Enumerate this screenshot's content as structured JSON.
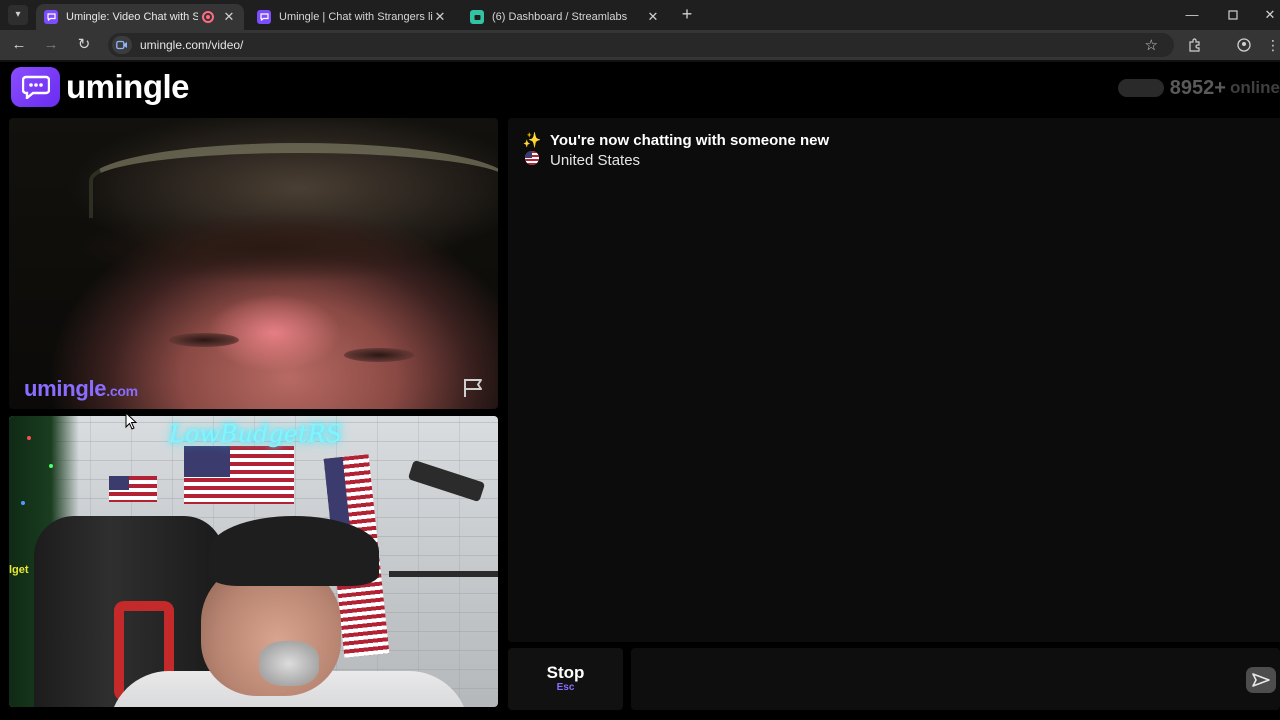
{
  "browser": {
    "tabs": [
      {
        "title": "Umingle: Video Chat with St",
        "active": true,
        "recording": true
      },
      {
        "title": "Umingle | Chat with Strangers li",
        "active": false,
        "recording": false
      },
      {
        "title": "(6) Dashboard / Streamlabs",
        "active": false,
        "recording": false
      }
    ],
    "url": "umingle.com/video/",
    "icons": [
      "tab-search-icon",
      "back-icon",
      "forward-icon",
      "reload-icon",
      "video-site-icon",
      "bookmark-star-icon",
      "extensions-icon",
      "profile-icon",
      "menu-icon",
      "minimize-icon",
      "maximize-icon",
      "close-icon"
    ]
  },
  "header": {
    "logo_text": "umingle",
    "online_count": "8952+",
    "online_label": "online"
  },
  "remote_video": {
    "watermark_brand": "umingle",
    "watermark_suffix": ".com"
  },
  "local_video": {
    "neon_sign": "LowBudgetRS",
    "side_text": "lget"
  },
  "chat": {
    "messages": [
      {
        "emoji": "✨",
        "text": "You're now chatting with someone new"
      },
      {
        "emoji": "🇺🇸",
        "text": "United States"
      }
    ]
  },
  "controls": {
    "stop_label": "Stop",
    "stop_hotkey": "Esc",
    "message_placeholder": ""
  },
  "colors": {
    "brand_purple": "#7c4dff",
    "page_background": "#000000",
    "chat_background": "#0c0c0c"
  }
}
